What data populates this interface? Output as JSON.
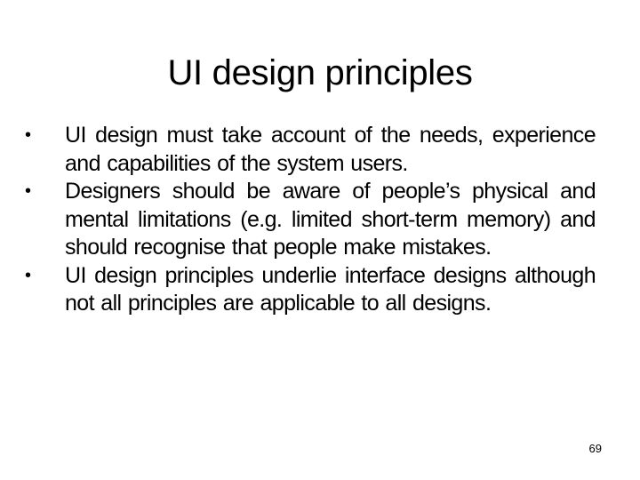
{
  "slide": {
    "title": "UI design principles",
    "bullet_glyph": "•",
    "bullets": [
      {
        "text": "UI design must take account of the needs, experience and capabilities of the system users."
      },
      {
        "text": "Designers should be aware of people’s physical and mental limitations (e.g. limited short-term memory) and should recognise that people make mistakes."
      },
      {
        "text": "UI design principles underlie interface designs although not all principles are applicable to all designs."
      }
    ],
    "page_number": "69"
  }
}
